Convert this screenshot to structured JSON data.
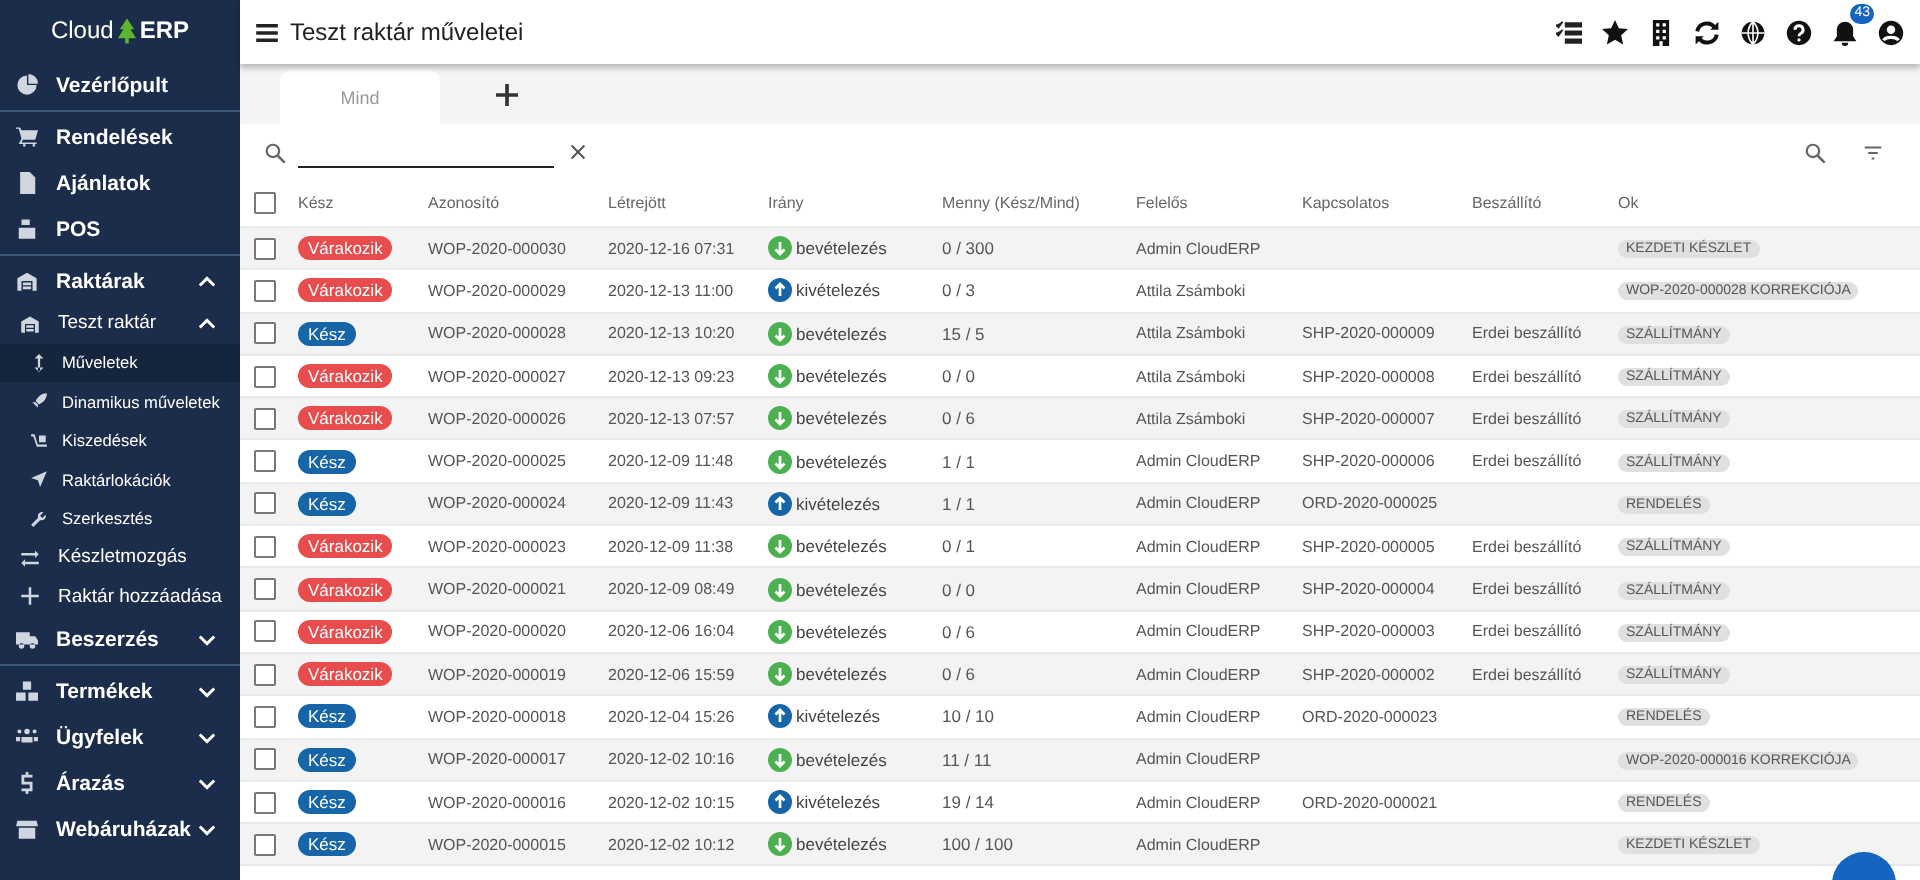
{
  "sidebar": {
    "logo_left": "Cloud",
    "logo_right": "ERP",
    "sections": [
      [
        {
          "label": "Vezérlőpult",
          "selected": false
        }
      ],
      [
        {
          "label": "Rendelések",
          "selected": false
        },
        {
          "label": "Ajánlatok",
          "selected": false
        },
        {
          "label": "POS",
          "selected": false
        }
      ],
      [
        {
          "label": "Raktárak",
          "selected": false,
          "expanded": true,
          "children": [
            {
              "label": "Teszt raktár",
              "selected": false,
              "expanded": true,
              "children": [
                {
                  "label": "Műveletek",
                  "selected": true
                },
                {
                  "label": "Dinamikus műveletek",
                  "selected": false
                },
                {
                  "label": "Kiszedések",
                  "selected": false
                },
                {
                  "label": "Raktárlokációk",
                  "selected": false
                },
                {
                  "label": "Szerkesztés",
                  "selected": false
                }
              ]
            },
            {
              "label": "Készletmozgás",
              "selected": false
            },
            {
              "label": "Raktár hozzáadása",
              "selected": false
            }
          ]
        },
        {
          "label": "Beszerzés",
          "selected": false,
          "expanded": false
        }
      ],
      [
        {
          "label": "Termékek",
          "selected": false,
          "expanded": false
        },
        {
          "label": "Ügyfelek",
          "selected": false,
          "expanded": false
        },
        {
          "label": "Árazás",
          "selected": false,
          "expanded": false
        },
        {
          "label": "Webáruházak",
          "selected": false,
          "expanded": false
        }
      ]
    ]
  },
  "header": {
    "title": "Teszt raktár műveletei",
    "notification_count": "43"
  },
  "tabs": [
    {
      "label": "Mind",
      "selected": true
    }
  ],
  "table": {
    "all_checked": false,
    "columns": [
      "Kész",
      "Azonosító",
      "Létrejött",
      "Irány",
      "Menny (Kész/Mind)",
      "Felelős",
      "Kapcsolatos",
      "Beszállító",
      "Ok"
    ],
    "rows": [
      {
        "checked": false,
        "status": {
          "kind": "waiting",
          "label": "Várakozik"
        },
        "id": "WOP-2020-000030",
        "created": "2020-12-16 07:31",
        "direction": {
          "kind": "in",
          "label": "bevételezés"
        },
        "qty": "0 / 300",
        "owner": "Admin CloudERP",
        "related": "",
        "supplier": "",
        "reason": "KEZDETI KÉSZLET"
      },
      {
        "checked": false,
        "status": {
          "kind": "waiting",
          "label": "Várakozik"
        },
        "id": "WOP-2020-000029",
        "created": "2020-12-13 11:00",
        "direction": {
          "kind": "out",
          "label": "kivételezés"
        },
        "qty": "0 / 3",
        "owner": "Attila Zsámboki",
        "related": "",
        "supplier": "",
        "reason": "WOP-2020-000028 KORREKCIÓJA"
      },
      {
        "checked": false,
        "status": {
          "kind": "ready",
          "label": "Kész"
        },
        "id": "WOP-2020-000028",
        "created": "2020-12-13 10:20",
        "direction": {
          "kind": "in",
          "label": "bevételezés"
        },
        "qty": "15 / 5",
        "owner": "Attila Zsámboki",
        "related": "SHP-2020-000009",
        "supplier": "Erdei beszállító",
        "reason": "SZÁLLÍTMÁNY"
      },
      {
        "checked": false,
        "status": {
          "kind": "waiting",
          "label": "Várakozik"
        },
        "id": "WOP-2020-000027",
        "created": "2020-12-13 09:23",
        "direction": {
          "kind": "in",
          "label": "bevételezés"
        },
        "qty": "0 / 0",
        "owner": "Attila Zsámboki",
        "related": "SHP-2020-000008",
        "supplier": "Erdei beszállító",
        "reason": "SZÁLLÍTMÁNY"
      },
      {
        "checked": false,
        "status": {
          "kind": "waiting",
          "label": "Várakozik"
        },
        "id": "WOP-2020-000026",
        "created": "2020-12-13 07:57",
        "direction": {
          "kind": "in",
          "label": "bevételezés"
        },
        "qty": "0 / 6",
        "owner": "Attila Zsámboki",
        "related": "SHP-2020-000007",
        "supplier": "Erdei beszállító",
        "reason": "SZÁLLÍTMÁNY"
      },
      {
        "checked": false,
        "status": {
          "kind": "ready",
          "label": "Kész"
        },
        "id": "WOP-2020-000025",
        "created": "2020-12-09 11:48",
        "direction": {
          "kind": "in",
          "label": "bevételezés"
        },
        "qty": "1 / 1",
        "owner": "Admin CloudERP",
        "related": "SHP-2020-000006",
        "supplier": "Erdei beszállító",
        "reason": "SZÁLLÍTMÁNY"
      },
      {
        "checked": false,
        "status": {
          "kind": "ready",
          "label": "Kész"
        },
        "id": "WOP-2020-000024",
        "created": "2020-12-09 11:43",
        "direction": {
          "kind": "out",
          "label": "kivételezés"
        },
        "qty": "1 / 1",
        "owner": "Admin CloudERP",
        "related": "ORD-2020-000025",
        "supplier": "",
        "reason": "RENDELÉS"
      },
      {
        "checked": false,
        "status": {
          "kind": "waiting",
          "label": "Várakozik"
        },
        "id": "WOP-2020-000023",
        "created": "2020-12-09 11:38",
        "direction": {
          "kind": "in",
          "label": "bevételezés"
        },
        "qty": "0 / 1",
        "owner": "Admin CloudERP",
        "related": "SHP-2020-000005",
        "supplier": "Erdei beszállító",
        "reason": "SZÁLLÍTMÁNY"
      },
      {
        "checked": false,
        "status": {
          "kind": "waiting",
          "label": "Várakozik"
        },
        "id": "WOP-2020-000021",
        "created": "2020-12-09 08:49",
        "direction": {
          "kind": "in",
          "label": "bevételezés"
        },
        "qty": "0 / 0",
        "owner": "Admin CloudERP",
        "related": "SHP-2020-000004",
        "supplier": "Erdei beszállító",
        "reason": "SZÁLLÍTMÁNY"
      },
      {
        "checked": false,
        "status": {
          "kind": "waiting",
          "label": "Várakozik"
        },
        "id": "WOP-2020-000020",
        "created": "2020-12-06 16:04",
        "direction": {
          "kind": "in",
          "label": "bevételezés"
        },
        "qty": "0 / 6",
        "owner": "Admin CloudERP",
        "related": "SHP-2020-000003",
        "supplier": "Erdei beszállító",
        "reason": "SZÁLLÍTMÁNY"
      },
      {
        "checked": false,
        "status": {
          "kind": "waiting",
          "label": "Várakozik"
        },
        "id": "WOP-2020-000019",
        "created": "2020-12-06 15:59",
        "direction": {
          "kind": "in",
          "label": "bevételezés"
        },
        "qty": "0 / 6",
        "owner": "Admin CloudERP",
        "related": "SHP-2020-000002",
        "supplier": "Erdei beszállító",
        "reason": "SZÁLLÍTMÁNY"
      },
      {
        "checked": false,
        "status": {
          "kind": "ready",
          "label": "Kész"
        },
        "id": "WOP-2020-000018",
        "created": "2020-12-04 15:26",
        "direction": {
          "kind": "out",
          "label": "kivételezés"
        },
        "qty": "10 / 10",
        "owner": "Admin CloudERP",
        "related": "ORD-2020-000023",
        "supplier": "",
        "reason": "RENDELÉS"
      },
      {
        "checked": false,
        "status": {
          "kind": "ready",
          "label": "Kész"
        },
        "id": "WOP-2020-000017",
        "created": "2020-12-02 10:16",
        "direction": {
          "kind": "in",
          "label": "bevételezés"
        },
        "qty": "11 / 11",
        "owner": "Admin CloudERP",
        "related": "",
        "supplier": "",
        "reason": "WOP-2020-000016 KORREKCIÓJA"
      },
      {
        "checked": false,
        "status": {
          "kind": "ready",
          "label": "Kész"
        },
        "id": "WOP-2020-000016",
        "created": "2020-12-02 10:15",
        "direction": {
          "kind": "out",
          "label": "kivételezés"
        },
        "qty": "19 / 14",
        "owner": "Admin CloudERP",
        "related": "ORD-2020-000021",
        "supplier": "",
        "reason": "RENDELÉS"
      },
      {
        "checked": false,
        "status": {
          "kind": "ready",
          "label": "Kész"
        },
        "id": "WOP-2020-000015",
        "created": "2020-12-02 10:12",
        "direction": {
          "kind": "in",
          "label": "bevételezés"
        },
        "qty": "100 / 100",
        "owner": "Admin CloudERP",
        "related": "",
        "supplier": "",
        "reason": "KEZDETI KÉSZLET"
      }
    ]
  }
}
